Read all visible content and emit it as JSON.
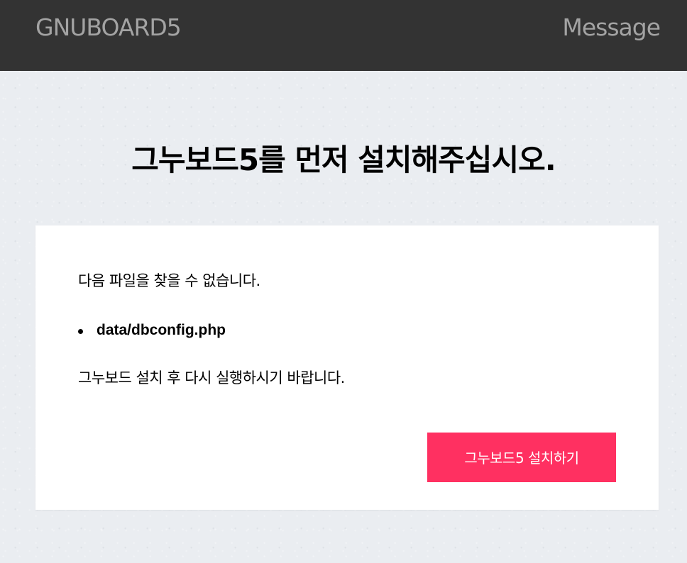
{
  "header": {
    "brand": "GNUBOARD5",
    "title": "Message"
  },
  "main": {
    "heading": "그누보드5를 먼저 설치해주십시오.",
    "notice": "다음 파일을 찾을 수 없습니다.",
    "missing_files": [
      "data/dbconfig.php"
    ],
    "retry_message": "그누보드 설치 후 다시 실행하시기 바랍니다.",
    "install_button_label": "그누보드5 설치하기"
  },
  "colors": {
    "header_background": "#333333",
    "header_text": "#a3a3a3",
    "page_background": "#eaedf1",
    "panel_background": "#ffffff",
    "button_background": "#ff3061",
    "button_text": "#ffffff"
  }
}
